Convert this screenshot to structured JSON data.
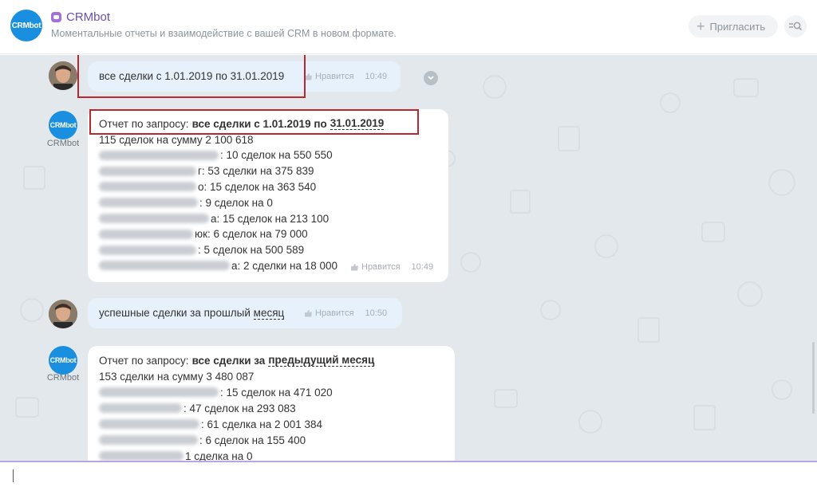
{
  "header": {
    "logo_text": "CRMbot",
    "title": "CRMbot",
    "subtitle": "Моментальные отчеты и взаимодействие с вашей CRM в новом формате.",
    "invite_label": "Пригласить",
    "accent_color": "#1a8fe0",
    "title_color": "#6a4fa8"
  },
  "messages": {
    "m1": {
      "text": "все сделки с 1.01.2019 по 31.01.2019",
      "like": "Нравится",
      "time": "10:49"
    },
    "m2": {
      "sender": "CRMbot",
      "avatar_text": "CRMbot",
      "query_prefix": "Отчет по запросу: ",
      "query_bold_1": "все сделки с 1.01.2019 по ",
      "query_bold_2": "31.01.2019",
      "summary": "115 сделок на сумму 2 100 618",
      "rows": [
        {
          "name_prefix": "",
          "text": ": 10 сделок на 550 550"
        },
        {
          "name_prefix": "",
          "text": "г: 53 сделки на 375 839"
        },
        {
          "name_prefix": "",
          "text": "о: 15 сделок на 363 540"
        },
        {
          "name_prefix": "",
          "text": ": 9 сделок на 0"
        },
        {
          "name_prefix": "",
          "text": "а: 15 сделок на 213 100"
        },
        {
          "name_prefix": "",
          "text": "юк: 6 сделок на 79 000"
        },
        {
          "name_prefix": "",
          "text": ": 5 сделок на 500 589"
        },
        {
          "name_prefix": "",
          "text": "а: 2 сделки на 18 000"
        }
      ],
      "like": "Нравится",
      "time": "10:49"
    },
    "m3": {
      "text_1": "успешные сделки за прошлый ",
      "text_2": "месяц",
      "like": "Нравится",
      "time": "10:50"
    },
    "m4": {
      "sender": "CRMbot",
      "avatar_text": "CRMbot",
      "query_prefix": "Отчет по запросу: ",
      "query_bold_1": "все сделки за ",
      "query_bold_2": "предыдущий месяц",
      "summary": "153 сделки на сумму 3 480 087",
      "rows": [
        {
          "text": ": 15 сделок на 471 020"
        },
        {
          "text": ": 47 сделок на 293 083"
        },
        {
          "text": ": 61 сделка на 2 001 384"
        },
        {
          "text": ": 6 сделок на 155 400"
        },
        {
          "text": "1 сделка на 0"
        }
      ]
    }
  }
}
